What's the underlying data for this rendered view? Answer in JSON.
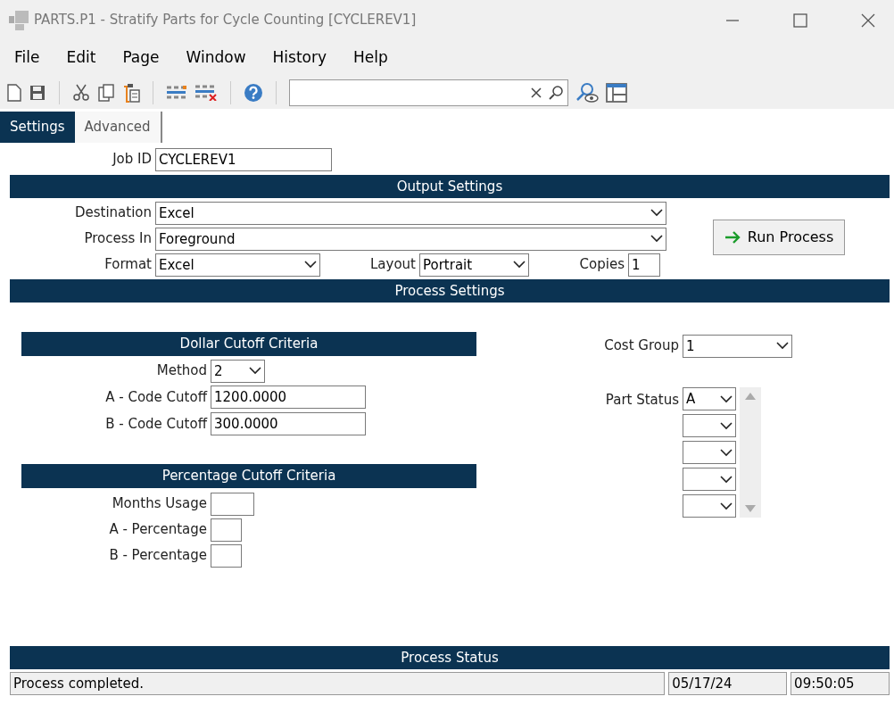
{
  "window": {
    "title": "PARTS.P1 - Stratify Parts for Cycle Counting [CYCLEREV1]"
  },
  "menu": [
    "File",
    "Edit",
    "Page",
    "Window",
    "History",
    "Help"
  ],
  "tabs": [
    {
      "label": "Settings",
      "selected": true
    },
    {
      "label": "Advanced",
      "selected": false
    }
  ],
  "job_id": {
    "label": "Job ID",
    "value": "CYCLEREV1"
  },
  "output_settings": {
    "title": "Output Settings",
    "destination": {
      "label": "Destination",
      "value": "Excel"
    },
    "process_in": {
      "label": "Process In",
      "value": "Foreground"
    },
    "format": {
      "label": "Format",
      "value": "Excel"
    },
    "layout": {
      "label": "Layout",
      "value": "Portrait"
    },
    "copies": {
      "label": "Copies",
      "value": "1"
    },
    "run_button": "Run Process"
  },
  "process_settings": {
    "title": "Process Settings",
    "dollar_cutoff": {
      "title": "Dollar Cutoff Criteria",
      "method": {
        "label": "Method",
        "value": "2"
      },
      "a_code_cutoff": {
        "label": "A - Code Cutoff",
        "value": "1200.0000"
      },
      "b_code_cutoff": {
        "label": "B - Code Cutoff",
        "value": "300.0000"
      }
    },
    "percentage_cutoff": {
      "title": "Percentage Cutoff Criteria",
      "months_usage": {
        "label": "Months Usage"
      },
      "a_percentage": {
        "label": "A - Percentage"
      },
      "b_percentage": {
        "label": "B - Percentage"
      }
    },
    "cost_group": {
      "label": "Cost Group",
      "value": "1"
    },
    "part_status": {
      "label": "Part Status",
      "entries": [
        {
          "kind": "select",
          "value": "A"
        },
        {
          "kind": "select"
        },
        {
          "kind": "select"
        },
        {
          "kind": "select"
        },
        {
          "kind": "select"
        }
      ]
    }
  },
  "process_status": {
    "title": "Process Status",
    "message": "Process completed.",
    "date": "05/17/24",
    "time": "09:50:05"
  }
}
